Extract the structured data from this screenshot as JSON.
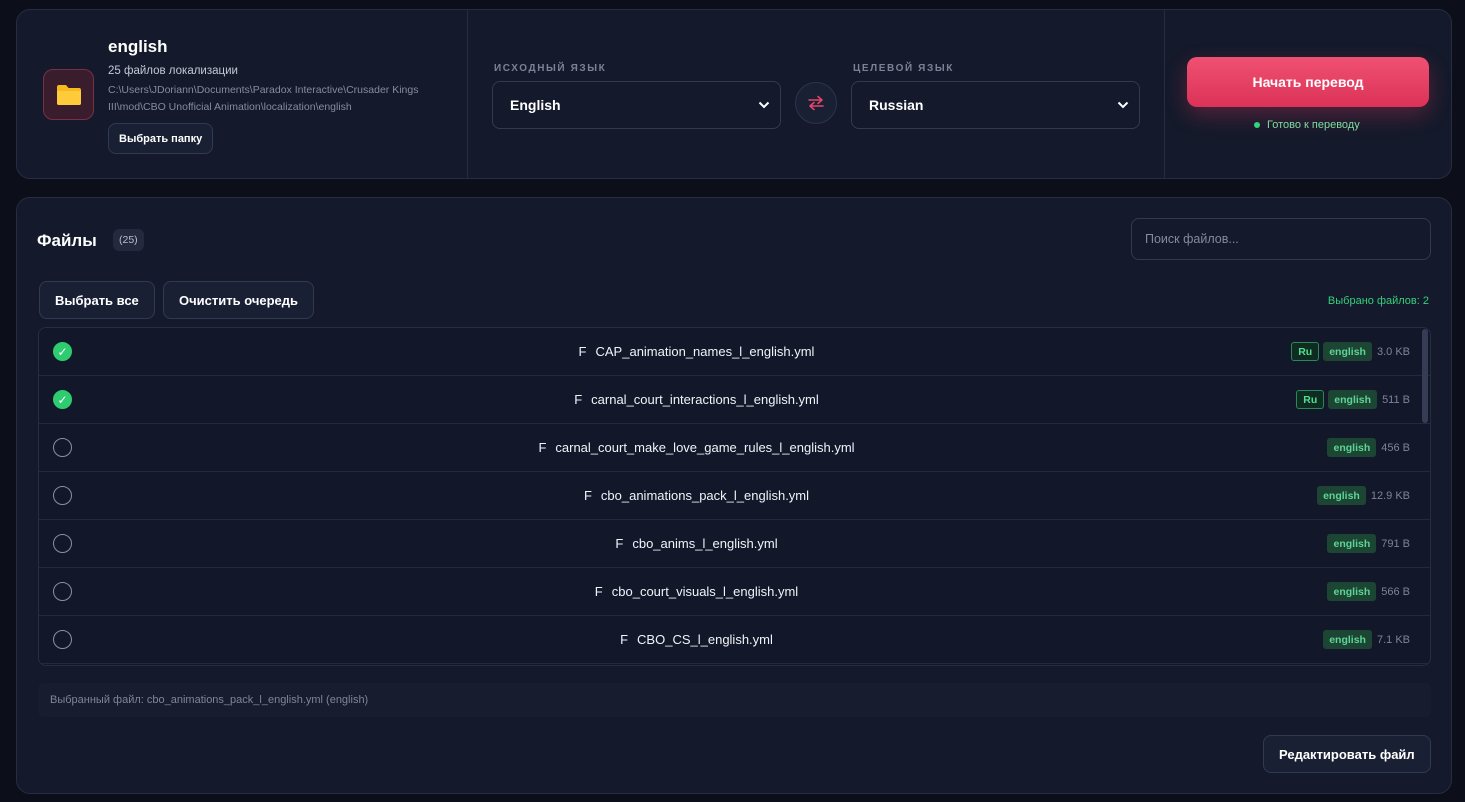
{
  "folder": {
    "name": "english",
    "count_text": "25 файлов локализации",
    "path": "C:\\Users\\JDoriann\\Documents\\Paradox Interactive\\Crusader Kings III\\mod\\CBO Unofficial Animation\\localization\\english",
    "choose_button": "Выбрать папку",
    "icon": "folder-icon"
  },
  "languages": {
    "source_label": "ИСХОДНЫЙ ЯЗЫК",
    "source_value": "English",
    "target_label": "ЦЕЛЕВОЙ ЯЗЫК",
    "target_value": "Russian",
    "swap_icon": "swap-arrows-icon"
  },
  "translate": {
    "start_button": "Начать перевод",
    "status": "Готово к переводу"
  },
  "files": {
    "title": "Файлы",
    "count": "(25)",
    "search_placeholder": "Поиск файлов...",
    "select_all": "Выбрать все",
    "clear_queue": "Очистить очередь",
    "selected_count": "Выбрано файлов: 2",
    "items": [
      {
        "icon": "F",
        "name": "CAP_animation_names_l_english.yml",
        "ru": "Ru",
        "lang": "english",
        "size": "3.0 KB",
        "checked": true
      },
      {
        "icon": "F",
        "name": "carnal_court_interactions_l_english.yml",
        "ru": "Ru",
        "lang": "english",
        "size": "511 B",
        "checked": true
      },
      {
        "icon": "F",
        "name": "carnal_court_make_love_game_rules_l_english.yml",
        "ru": "",
        "lang": "english",
        "size": "456 B",
        "checked": false
      },
      {
        "icon": "F",
        "name": "cbo_animations_pack_l_english.yml",
        "ru": "",
        "lang": "english",
        "size": "12.9 KB",
        "checked": false
      },
      {
        "icon": "F",
        "name": "cbo_anims_l_english.yml",
        "ru": "",
        "lang": "english",
        "size": "791 B",
        "checked": false
      },
      {
        "icon": "F",
        "name": "cbo_court_visuals_l_english.yml",
        "ru": "",
        "lang": "english",
        "size": "566 B",
        "checked": false
      },
      {
        "icon": "F",
        "name": "CBO_CS_l_english.yml",
        "ru": "",
        "lang": "english",
        "size": "7.1 KB",
        "checked": false
      }
    ],
    "selected_file": "Выбранный файл: cbo_animations_pack_l_english.yml (english)",
    "edit_button": "Редактировать файл"
  },
  "colors": {
    "accent": "#e33a60",
    "success": "#2ecc71",
    "background": "#0c0f19",
    "panel": "#141a2b"
  }
}
